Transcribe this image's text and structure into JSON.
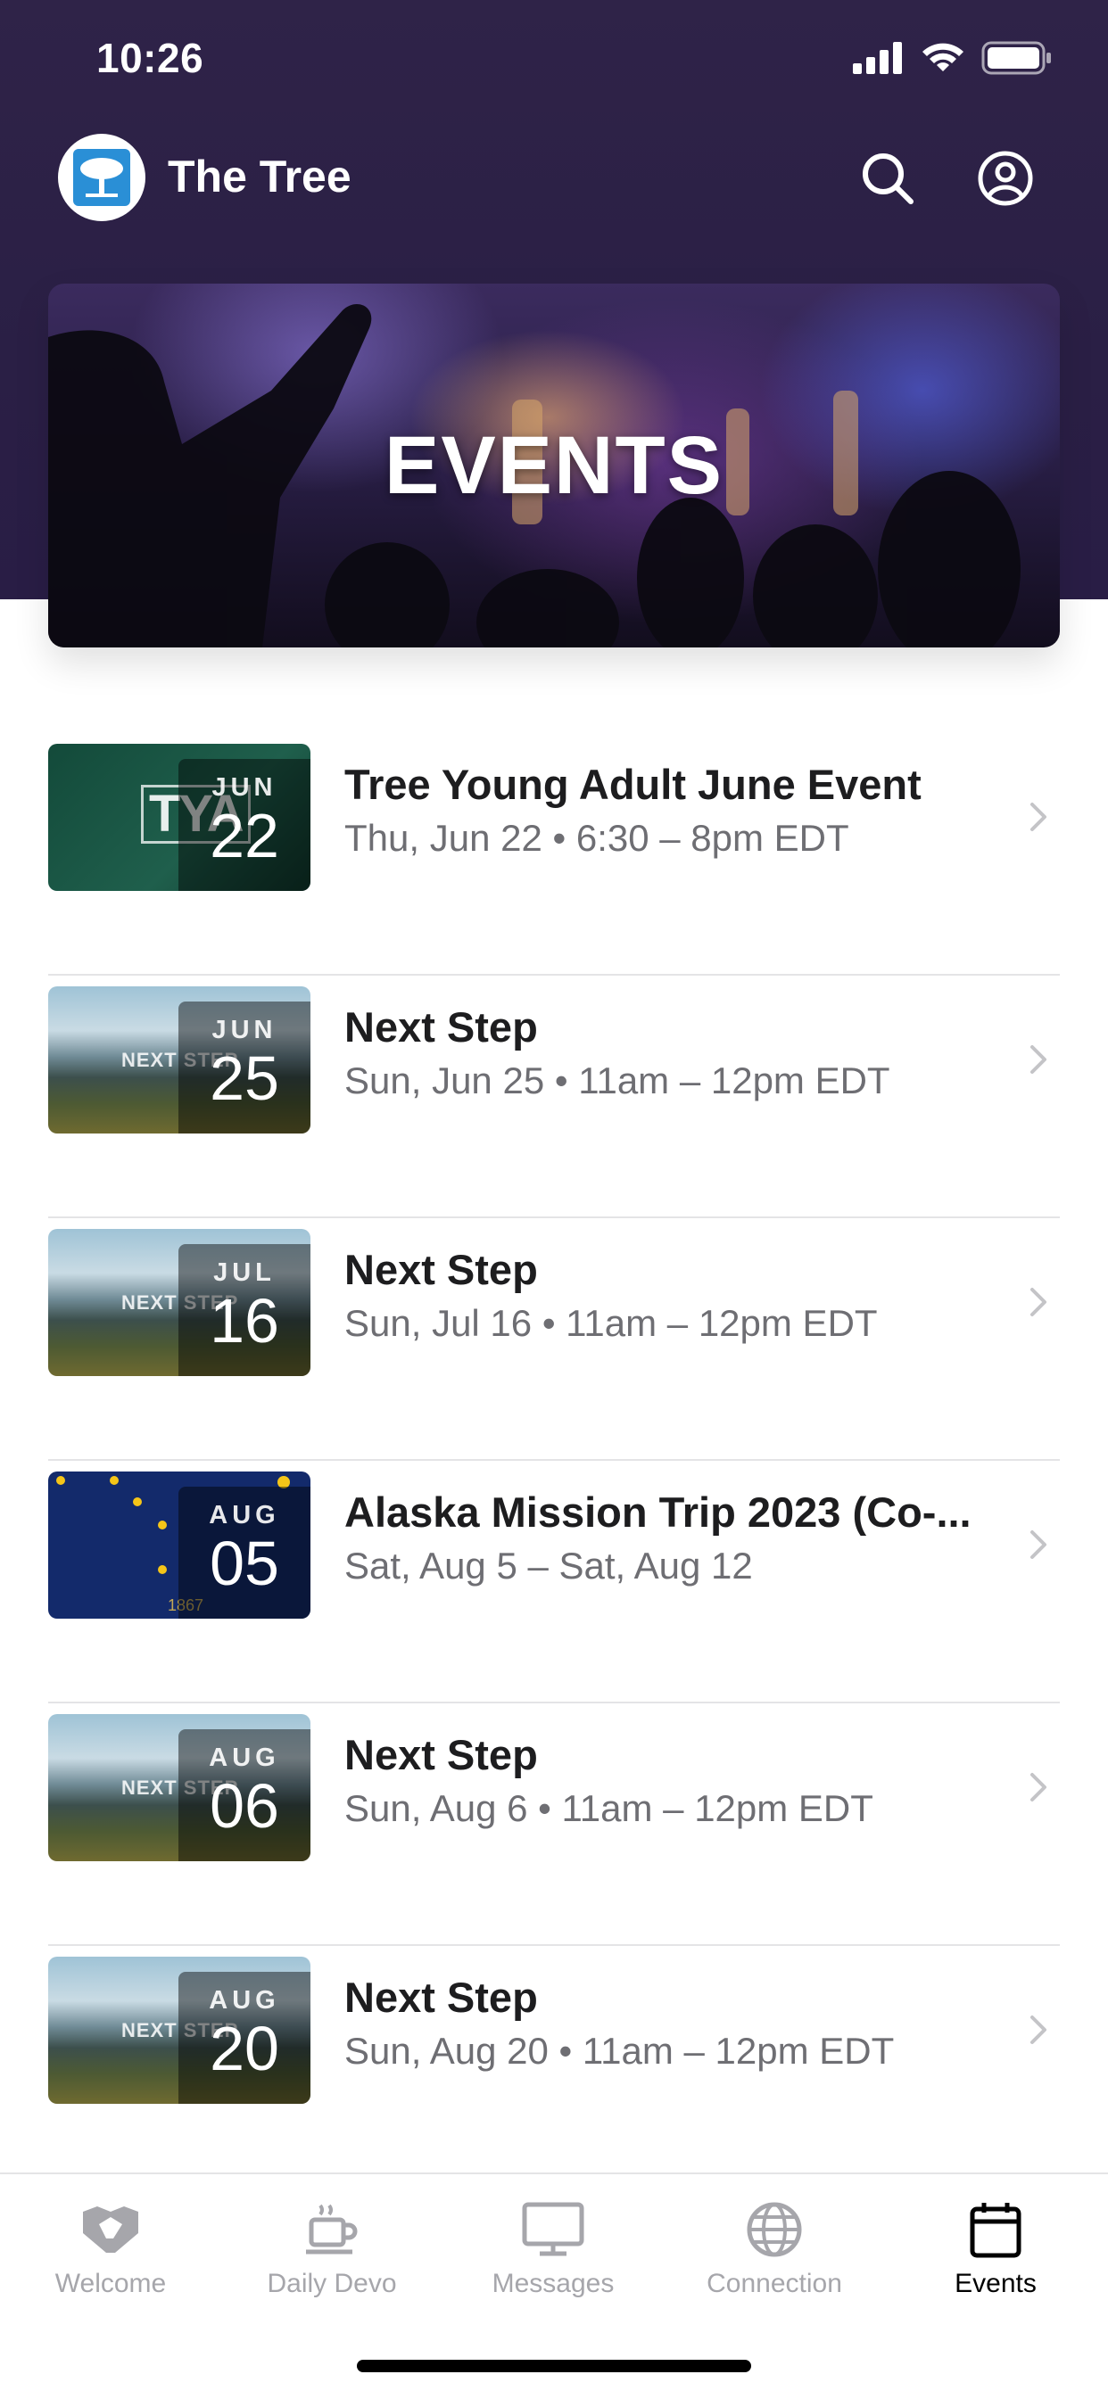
{
  "status_bar": {
    "time": "10:26"
  },
  "app": {
    "name": "The Tree"
  },
  "header_icons": [
    "search-icon",
    "profile-icon"
  ],
  "hero": {
    "title": "EVENTS"
  },
  "events": [
    {
      "month": "JUN",
      "day": "22",
      "title": "Tree Young Adult June Event",
      "subtitle": "Thu, Jun 22 • 6:30 – 8pm EDT",
      "thumb": "tya",
      "thumb_text": "TYA"
    },
    {
      "month": "JUN",
      "day": "25",
      "title": "Next Step",
      "subtitle": "Sun, Jun 25 • 11am – 12pm EDT",
      "thumb": "mountain",
      "thumb_text": "NEXT STEP"
    },
    {
      "month": "JUL",
      "day": "16",
      "title": "Next Step",
      "subtitle": "Sun, Jul 16 • 11am – 12pm EDT",
      "thumb": "mountain",
      "thumb_text": "NEXT STEP"
    },
    {
      "month": "AUG",
      "day": "05",
      "title": "Alaska Mission Trip 2023 (Co-...",
      "subtitle": "Sat, Aug 5 – Sat, Aug 12",
      "thumb": "alaska",
      "thumb_text": "1867"
    },
    {
      "month": "AUG",
      "day": "06",
      "title": "Next Step",
      "subtitle": "Sun, Aug 6 • 11am – 12pm EDT",
      "thumb": "mountain",
      "thumb_text": "NEXT STEP"
    },
    {
      "month": "AUG",
      "day": "20",
      "title": "Next Step",
      "subtitle": "Sun, Aug 20 • 11am – 12pm EDT",
      "thumb": "mountain",
      "thumb_text": "NEXT STEP"
    }
  ],
  "tabs": [
    {
      "label": "Welcome",
      "icon": "handshake-icon",
      "active": false
    },
    {
      "label": "Daily Devo",
      "icon": "coffee-cup-icon",
      "active": false
    },
    {
      "label": "Messages",
      "icon": "monitor-icon",
      "active": false
    },
    {
      "label": "Connection",
      "icon": "globe-icon",
      "active": false
    },
    {
      "label": "Events",
      "icon": "calendar-icon",
      "active": true
    }
  ],
  "colors": {
    "header_bg": "#2b1f46",
    "text_primary": "#1d1d1f",
    "text_secondary": "#6e6e73",
    "tab_inactive": "#a6a6ab"
  }
}
